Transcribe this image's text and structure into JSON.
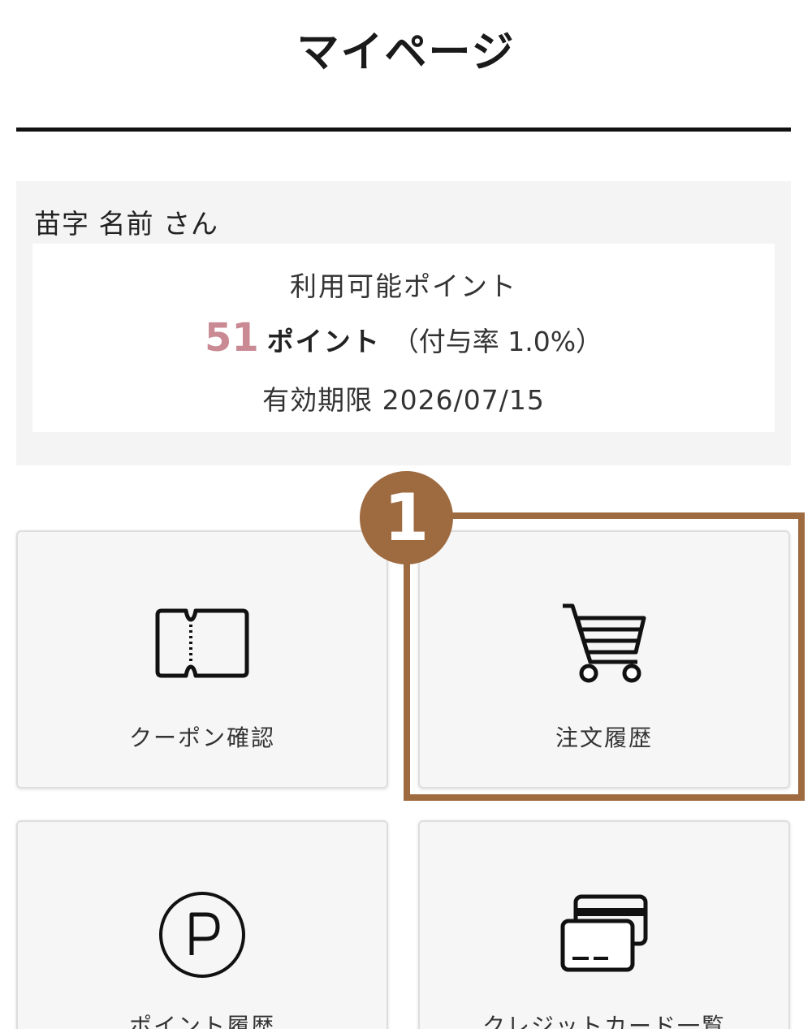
{
  "header": {
    "title": "マイページ"
  },
  "member": {
    "name": "苗字 名前 さん",
    "points_label": "利用可能ポイント",
    "points_value": "51",
    "points_unit": "ポイント",
    "points_rate": "（付与率 1.0%）",
    "expiry": "有効期限 2026/07/15",
    "accent_color": "#c98a93"
  },
  "menu": {
    "items": [
      {
        "label": "クーポン確認",
        "icon": "ticket-icon"
      },
      {
        "label": "注文履歴",
        "icon": "cart-icon"
      },
      {
        "label": "ポイント履歴",
        "icon": "point-icon"
      },
      {
        "label": "クレジットカード一覧",
        "icon": "credit-card-icon"
      }
    ]
  },
  "annotation": {
    "badge": "1",
    "color": "#9e6a40"
  }
}
